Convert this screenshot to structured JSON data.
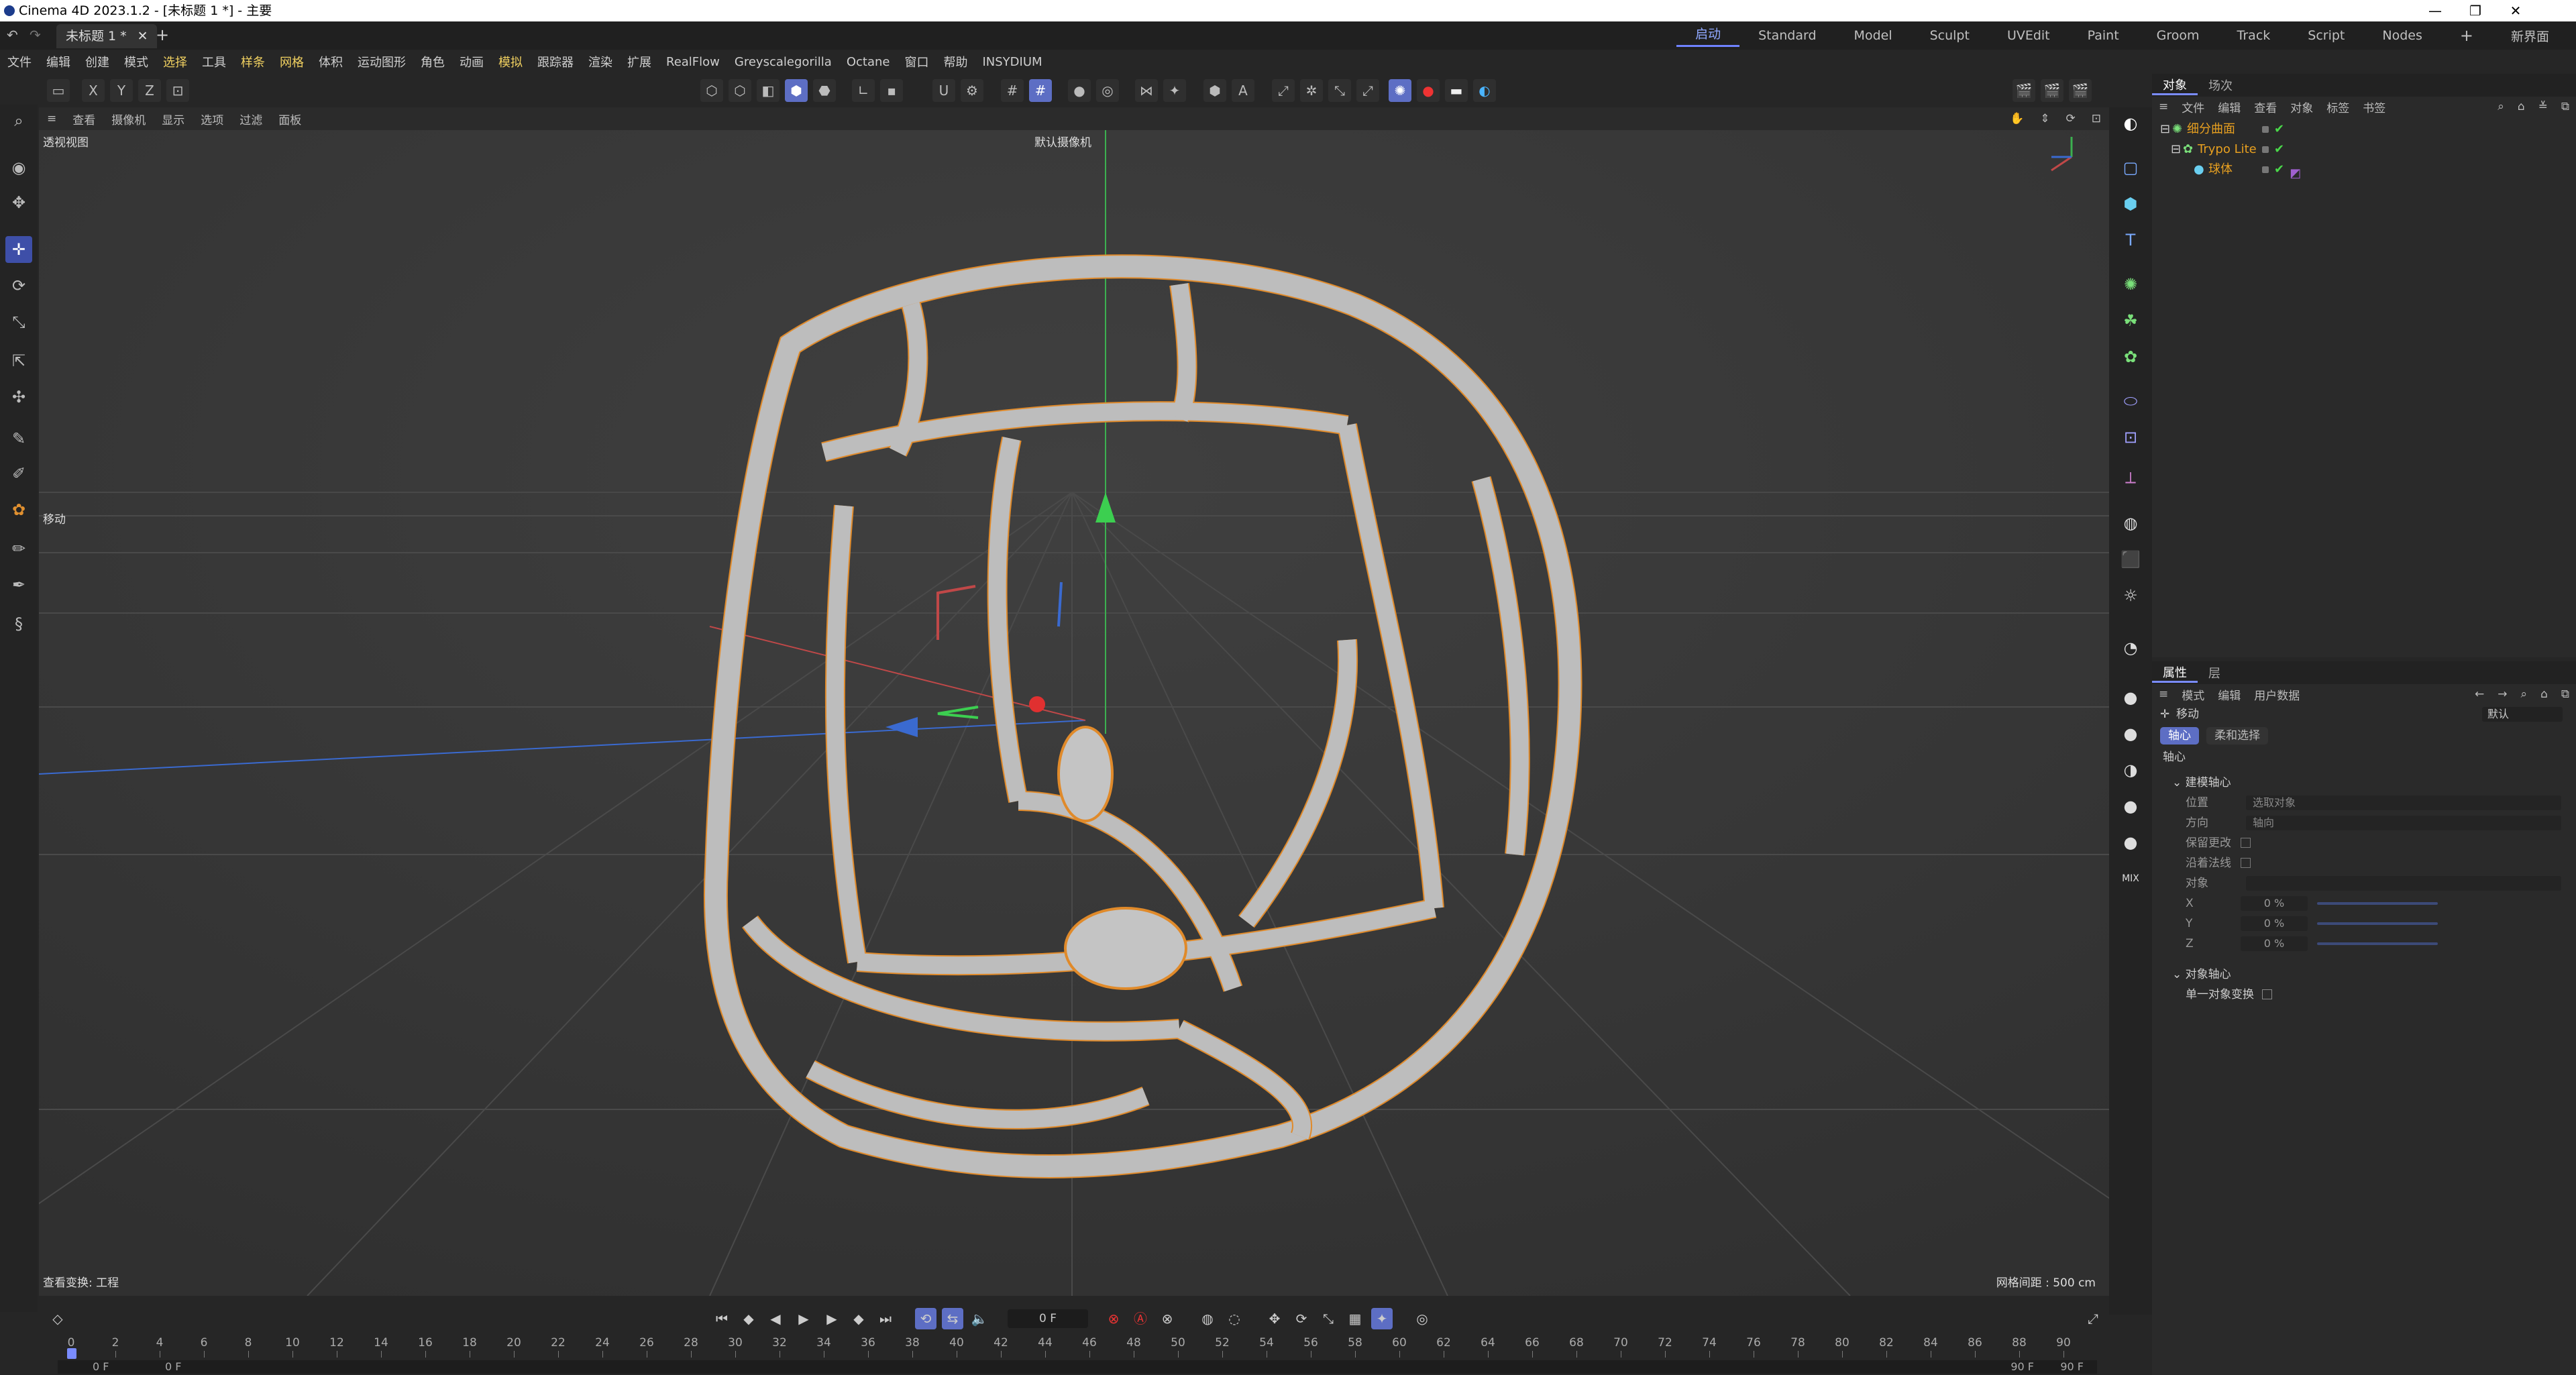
{
  "window": {
    "title": "Cinema 4D 2023.1.2 - [未标题 1 *] - 主要"
  },
  "doc_tab": {
    "label": "未标题 1 *"
  },
  "layouts": {
    "active": "启动",
    "items": [
      "Standard",
      "Model",
      "Sculpt",
      "UVEdit",
      "Paint",
      "Groom",
      "Track",
      "Script",
      "Nodes"
    ],
    "new_layout": "新界面"
  },
  "menu": [
    "文件",
    "编辑",
    "创建",
    "模式",
    "选择",
    "工具",
    "样条",
    "网格",
    "体积",
    "运动图形",
    "角色",
    "动画",
    "模拟",
    "跟踪器",
    "渲染",
    "扩展",
    "RealFlow",
    "Greyscalegorilla",
    "Octane",
    "窗口",
    "帮助",
    "INSYDIUM"
  ],
  "menu_highlight": [
    "选择",
    "样条",
    "网格",
    "模拟"
  ],
  "axes": {
    "x": "X",
    "y": "Y",
    "z": "Z"
  },
  "viewport": {
    "menu": [
      "查看",
      "摄像机",
      "显示",
      "选项",
      "过滤",
      "面板"
    ],
    "view_name": "透视视图",
    "camera": "默认摄像机",
    "tool_label": "移动",
    "status_left": "查看变换: 工程",
    "grid_info": "网格间距 : 500 cm"
  },
  "object_panel": {
    "tabs": [
      "对象",
      "场次"
    ],
    "menu": [
      "文件",
      "编辑",
      "查看",
      "对象",
      "标签",
      "书签"
    ],
    "objects": [
      {
        "name": "细分曲面",
        "color": "#e8a020",
        "depth": 0
      },
      {
        "name": "Trypo Lite",
        "color": "#e8a020",
        "depth": 1
      },
      {
        "name": "球体",
        "color": "#e8a020",
        "depth": 2
      }
    ]
  },
  "attr_panel": {
    "tabs": [
      "属性",
      "层"
    ],
    "menu": [
      "模式",
      "编辑",
      "用户数据"
    ],
    "tool": "移动",
    "preset": "默认",
    "sub_tabs": [
      "轴心",
      "柔和选择"
    ],
    "section_title": "轴心",
    "group1": "建模轴心",
    "fields": [
      {
        "label": "位置",
        "value": "选取对象"
      },
      {
        "label": "方向",
        "value": "轴向"
      }
    ],
    "checks": [
      "保留更改",
      "沿着法线"
    ],
    "object_label": "对象",
    "xyz": [
      {
        "label": "X",
        "value": "0 %"
      },
      {
        "label": "Y",
        "value": "0 %"
      },
      {
        "label": "Z",
        "value": "0 %"
      }
    ],
    "group2": "对象轴心",
    "single_object": "单一对象变换"
  },
  "timeline": {
    "current_frame": "0 F",
    "ticks": [
      "0",
      "2",
      "4",
      "6",
      "8",
      "10",
      "12",
      "14",
      "16",
      "18",
      "20",
      "22",
      "24",
      "26",
      "28",
      "30",
      "32",
      "34",
      "36",
      "38",
      "40",
      "42",
      "44",
      "46",
      "48",
      "50",
      "52",
      "54",
      "56",
      "58",
      "60",
      "62",
      "64",
      "66",
      "68",
      "70",
      "72",
      "74",
      "76",
      "78",
      "80",
      "82",
      "84",
      "86",
      "88",
      "90"
    ],
    "range_start": "0 F",
    "range_start2": "0 F",
    "range_end": "90 F",
    "range_end2": "90 F"
  },
  "colors": {
    "accent": "#5d6ec4",
    "selection_outline": "#e08a2a",
    "model": "#b8b8b8"
  }
}
